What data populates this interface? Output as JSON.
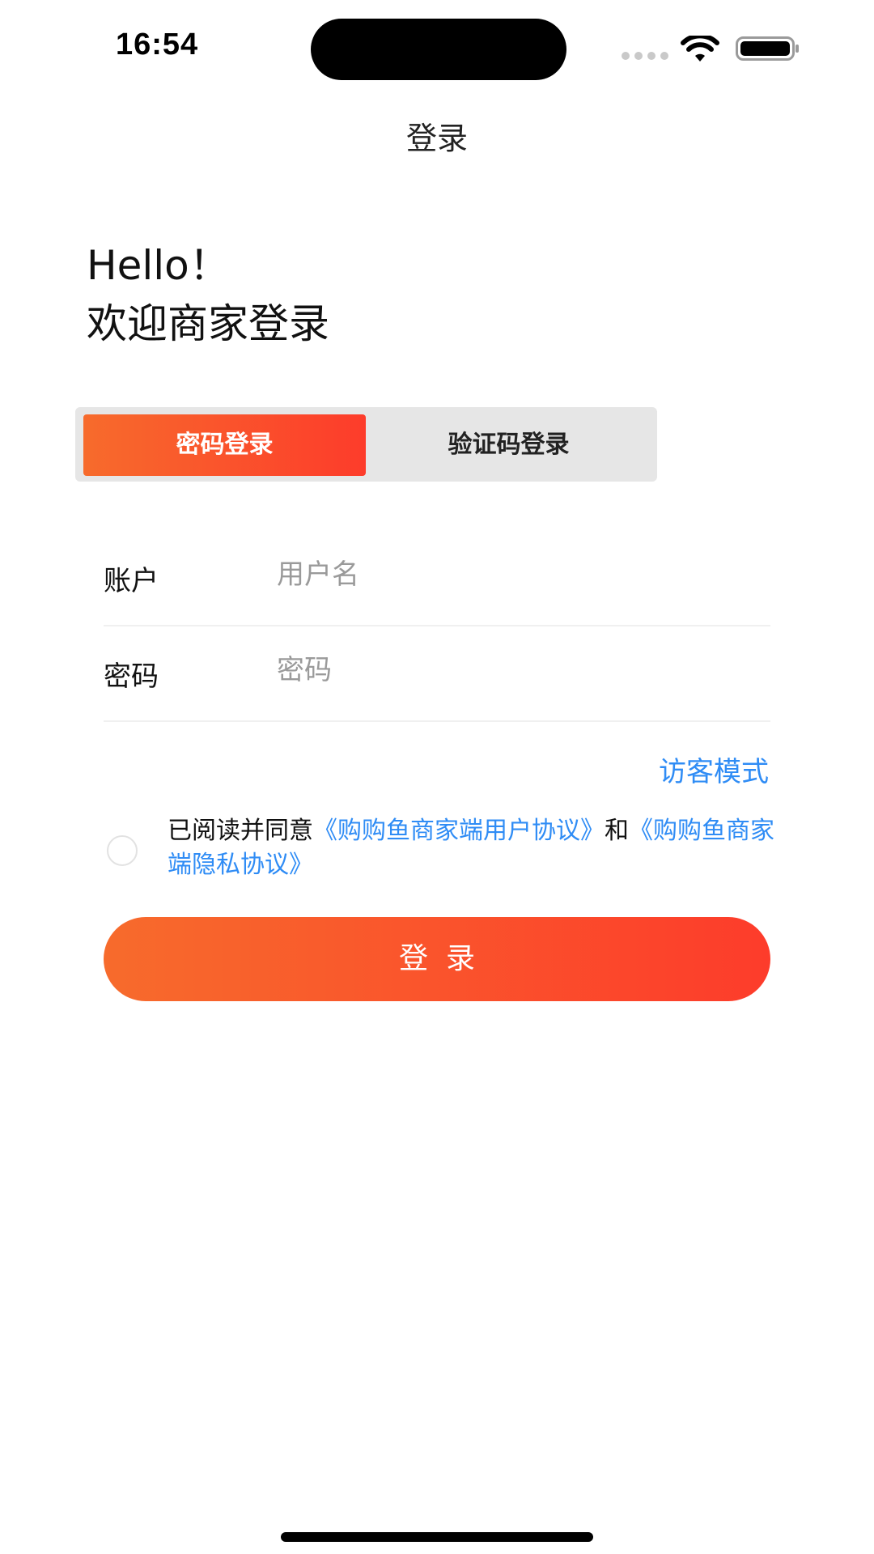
{
  "status_bar": {
    "time": "16:54",
    "wifi_icon": "wifi-icon",
    "battery_icon": "battery-full-icon",
    "signal_icon": "cellular-signal-icon"
  },
  "nav": {
    "title": "登录"
  },
  "greeting": {
    "line1": "Hello！",
    "line2": "欢迎商家登录"
  },
  "tabs": [
    {
      "label": "密码登录",
      "active": true
    },
    {
      "label": "验证码登录",
      "active": false
    }
  ],
  "form": {
    "account": {
      "label": "账户",
      "placeholder": "用户名",
      "value": ""
    },
    "password": {
      "label": "密码",
      "placeholder": "密码",
      "value": ""
    }
  },
  "guest_mode": "访客模式",
  "agreement": {
    "checked": false,
    "prefix": "已阅读并同意",
    "user_agreement": "《购购鱼商家端用户协议》",
    "conjunction": "和",
    "privacy_agreement": "《购购鱼商家端隐私协议》"
  },
  "login_button": "登录",
  "colors": {
    "accent_gradient_start": "#f76b2c",
    "accent_gradient_end": "#fd3c2b",
    "link": "#2f8cf5",
    "tab_bg": "#e6e6e6"
  }
}
